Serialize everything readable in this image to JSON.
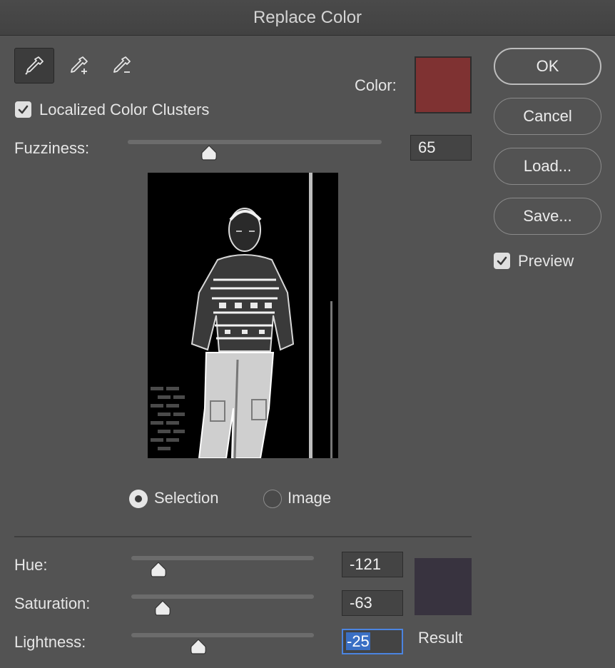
{
  "window": {
    "title": "Replace Color"
  },
  "tools": [
    {
      "icon": "eyedropper-icon",
      "active": true
    },
    {
      "icon": "eyedropper-plus-icon",
      "active": false
    },
    {
      "icon": "eyedropper-minus-icon",
      "active": false
    }
  ],
  "color": {
    "label": "Color:",
    "value": "#7f3232"
  },
  "localized_clusters": {
    "label": "Localized Color Clusters",
    "checked": true
  },
  "fuzziness": {
    "label": "Fuzziness:",
    "value": "65",
    "min": 0,
    "max": 200
  },
  "view_mode": {
    "selection_label": "Selection",
    "image_label": "Image",
    "selected": "selection"
  },
  "adjustments": {
    "hue": {
      "label": "Hue:",
      "value": "-121",
      "min": -180,
      "max": 180
    },
    "saturation": {
      "label": "Saturation:",
      "value": "-63",
      "min": -100,
      "max": 100
    },
    "lightness": {
      "label": "Lightness:",
      "value": "-25",
      "min": -100,
      "max": 100
    }
  },
  "result": {
    "label": "Result",
    "color": "#38333f"
  },
  "buttons": {
    "ok": "OK",
    "cancel": "Cancel",
    "load": "Load...",
    "save": "Save..."
  },
  "preview_checkbox": {
    "label": "Preview",
    "checked": true
  }
}
